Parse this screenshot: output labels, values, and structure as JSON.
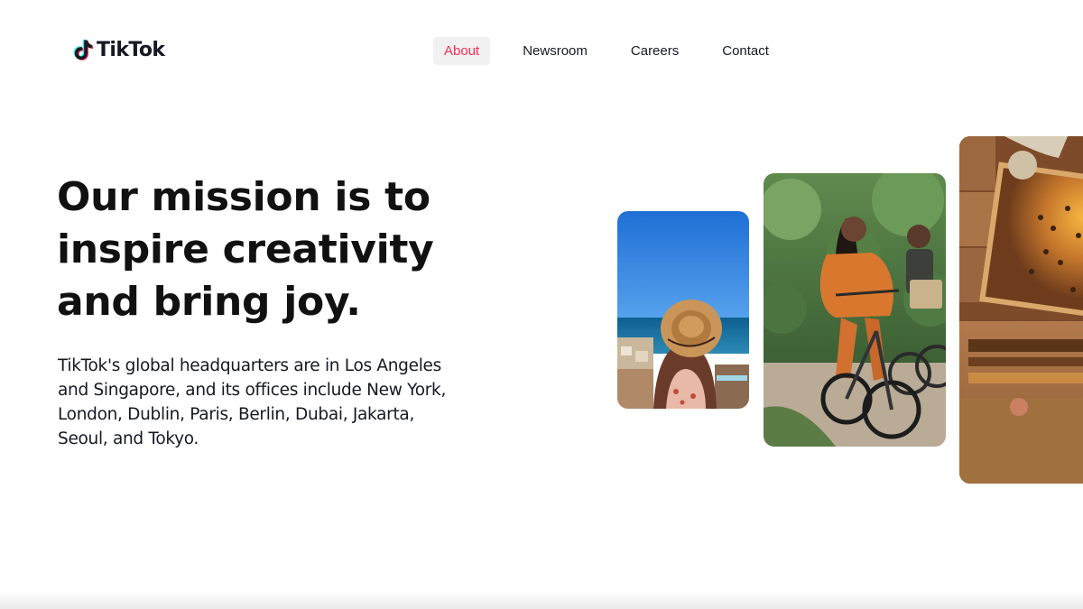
{
  "brand": {
    "name": "TikTok",
    "colors": {
      "cyan": "#25f4ee",
      "pink": "#fe2c55",
      "ink": "#161823"
    }
  },
  "nav": {
    "items": [
      {
        "label": "About",
        "active": true
      },
      {
        "label": "Newsroom",
        "active": false
      },
      {
        "label": "Careers",
        "active": false
      },
      {
        "label": "Contact",
        "active": false
      }
    ]
  },
  "hero": {
    "title": "Our mission is to inspire creativity and bring joy.",
    "body": "TikTok's global headquarters are in Los Angeles and Singapore, and its offices include New York, London, Dublin, Paris, Berlin, Dubai, Jakarta, Seoul, and Tokyo."
  },
  "gallery": {
    "images": [
      {
        "icon": "photo-woman-sun-hat-seaside"
      },
      {
        "icon": "photo-women-cycling"
      },
      {
        "icon": "photo-beekeeper-honeycomb"
      }
    ]
  }
}
